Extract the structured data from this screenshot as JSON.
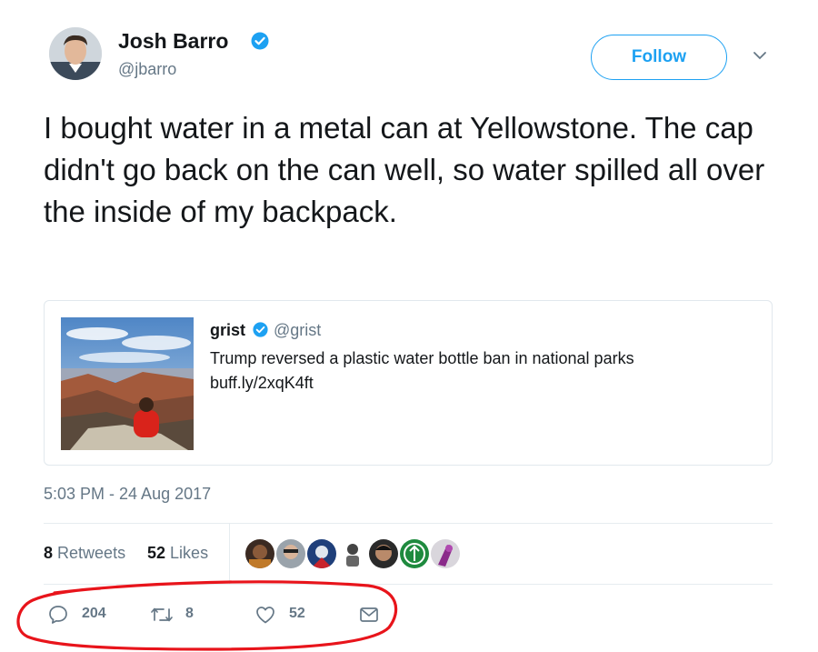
{
  "author": {
    "name": "Josh Barro",
    "handle": "@jbarro",
    "verified": true
  },
  "follow_label": "Follow",
  "tweet_text": "I bought water in a metal can at Yellowstone. The cap didn't go back on the can well, so water spilled all over the inside of my backpack.",
  "quoted": {
    "name": "grist",
    "handle": "@grist",
    "verified": true,
    "text": "Trump reversed a plastic water bottle ban in national parks",
    "link": "buff.ly/2xqK4ft"
  },
  "timestamp": "5:03 PM - 24 Aug 2017",
  "stats": {
    "retweets_count": "8",
    "retweets_label": "Retweets",
    "likes_count": "52",
    "likes_label": "Likes"
  },
  "actions": {
    "reply_count": "204",
    "retweet_count": "8",
    "like_count": "52"
  },
  "colors": {
    "accent": "#1da1f2",
    "secondary_text": "#657786",
    "annotation": "#e8141b"
  }
}
